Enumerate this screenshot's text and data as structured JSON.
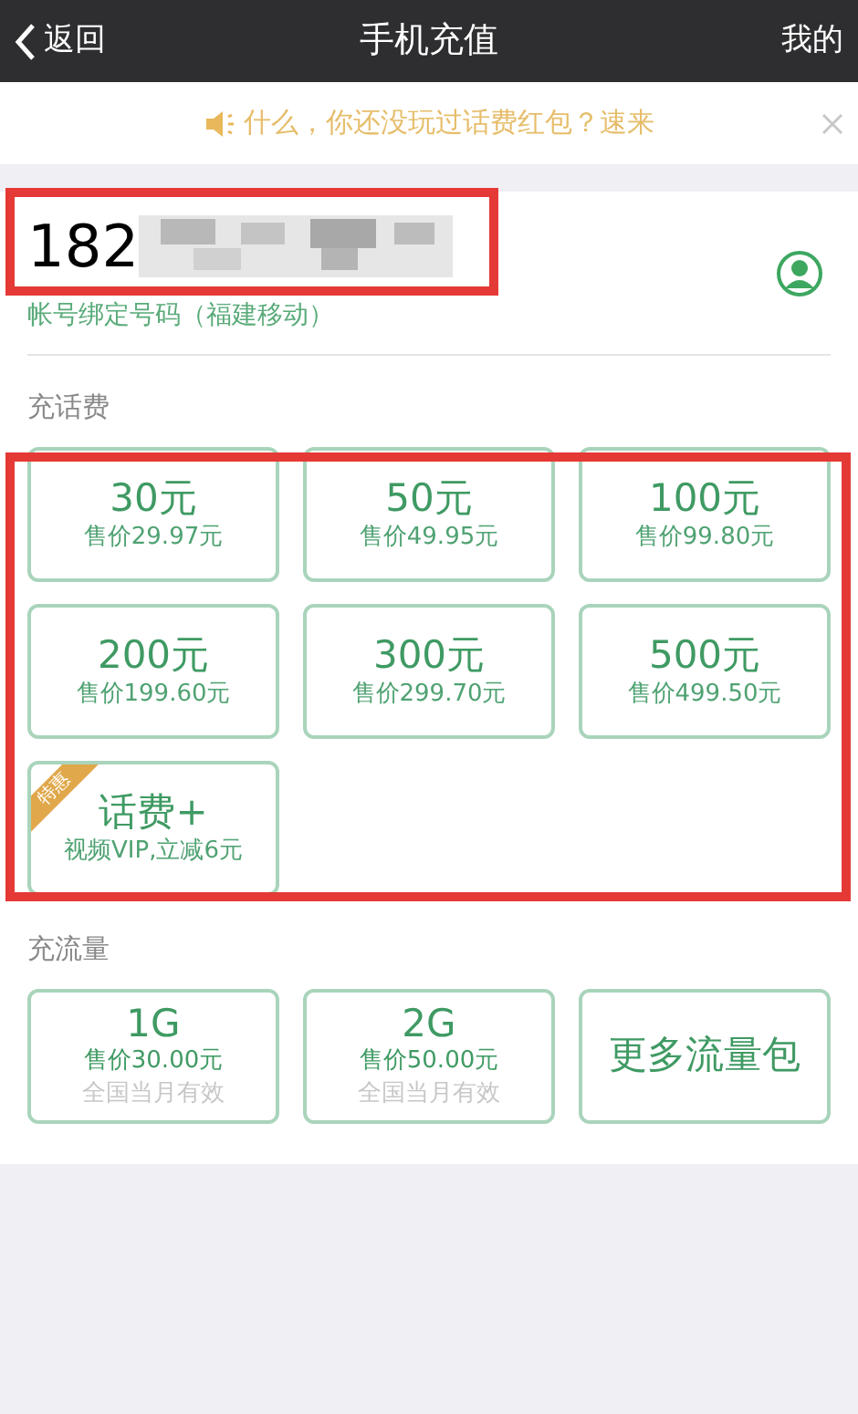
{
  "nav": {
    "back": "返回",
    "title": "手机充值",
    "right": "我的"
  },
  "notice": {
    "text": "什么，你还没玩过话费红包？速来",
    "closable": true
  },
  "account": {
    "number": "182",
    "masked": true,
    "caption": "帐号绑定号码（福建移动）",
    "highlighted": true
  },
  "recharge": {
    "heading": "充话费",
    "highlighted": true,
    "tiles": [
      {
        "kind": "amount",
        "amount": "30元",
        "price": "售价29.97元"
      },
      {
        "kind": "amount",
        "amount": "50元",
        "price": "售价49.95元"
      },
      {
        "kind": "amount",
        "amount": "100元",
        "price": "售价99.80元"
      },
      {
        "kind": "amount",
        "amount": "200元",
        "price": "售价199.60元"
      },
      {
        "kind": "amount",
        "amount": "300元",
        "price": "售价299.70元"
      },
      {
        "kind": "amount",
        "amount": "500元",
        "price": "售价499.50元"
      },
      {
        "kind": "promo",
        "badge": "特惠",
        "amount": "话费+",
        "price": "视频VIP,立减6元"
      }
    ]
  },
  "data": {
    "heading": "充流量",
    "tiles": [
      {
        "kind": "package",
        "amount": "1G",
        "price": "售价30.00元",
        "note": "全国当月有效"
      },
      {
        "kind": "package",
        "amount": "2G",
        "price": "售价50.00元",
        "note": "全国当月有效"
      },
      {
        "kind": "more",
        "label": "更多流量包"
      }
    ]
  }
}
